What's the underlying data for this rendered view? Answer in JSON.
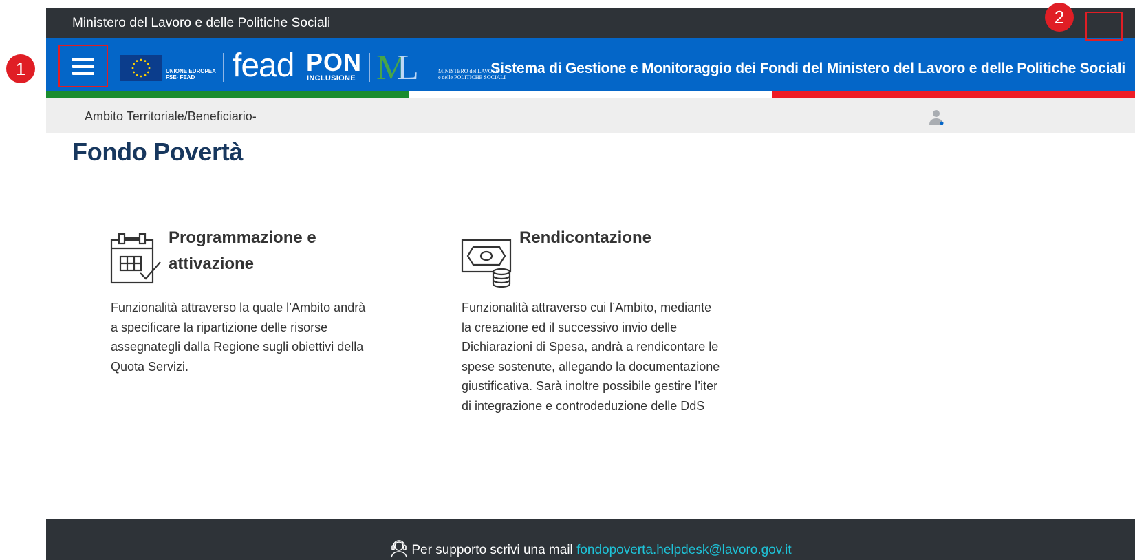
{
  "topbar": {
    "title": "Ministero del Lavoro e delle Politiche Sociali"
  },
  "header": {
    "eu_logo_text_line1": "UNIONE EUROPEA",
    "eu_logo_text_line2": "FSE- FEAD",
    "fead_logo": "fead",
    "pon_logo": "PON",
    "pon_logo_sub": "INCLUSIONE",
    "ministero_logo_line1": "MINISTERO del LAVORO",
    "ministero_logo_line2": "e delle POLITICHE SOCIALI",
    "system_title": "Sistema di Gestione e Monitoraggio dei Fondi del Ministero del Lavoro e delle Politiche Sociali",
    "menu_icon": "hamburger-icon",
    "settings_icon": "gear-icon"
  },
  "tricolor": [
    "#1a8c2e",
    "#ffffff",
    "#ee1c25"
  ],
  "breadcrumb": {
    "text": "Ambito Territoriale/Beneficiario-",
    "avatar_icon": "user-icon"
  },
  "page": {
    "title": "Fondo Povertà"
  },
  "cards": [
    {
      "icon": "calendar-check-icon",
      "title_line1": "Programmazione e",
      "title_line2": "attivazione",
      "lines": [
        "Funzionalità attraverso la quale l’Ambito andrà",
        "a specificare la ripartizione delle risorse",
        "assegnategli dalla Regione sugli obiettivi della",
        "Quota Servizi."
      ]
    },
    {
      "icon": "money-coins-icon",
      "title_line1": "Rendicontazione",
      "lines": [
        "Funzionalità attraverso cui l’Ambito, mediante",
        "la creazione ed il successivo invio delle",
        "Dichiarazioni di Spesa, andrà a rendicontare le",
        "spese sostenute, allegando la documentazione",
        "giustificativa. Sarà inoltre possibile gestire l’iter",
        "di integrazione e controdeduzione delle DdS"
      ]
    }
  ],
  "footer": {
    "icon": "headset-icon",
    "text": "Per supporto scrivi una mail",
    "email": "fondopoverta.helpdesk@lavoro.gov.it"
  },
  "annotations": {
    "badge1": "1",
    "badge2": "2"
  },
  "colors": {
    "header_blue": "#0466c8",
    "topbar_dark": "#2e3338",
    "title_navy": "#17375e",
    "annotation_red": "#e01e25",
    "link_cyan": "#1ec4d9"
  }
}
